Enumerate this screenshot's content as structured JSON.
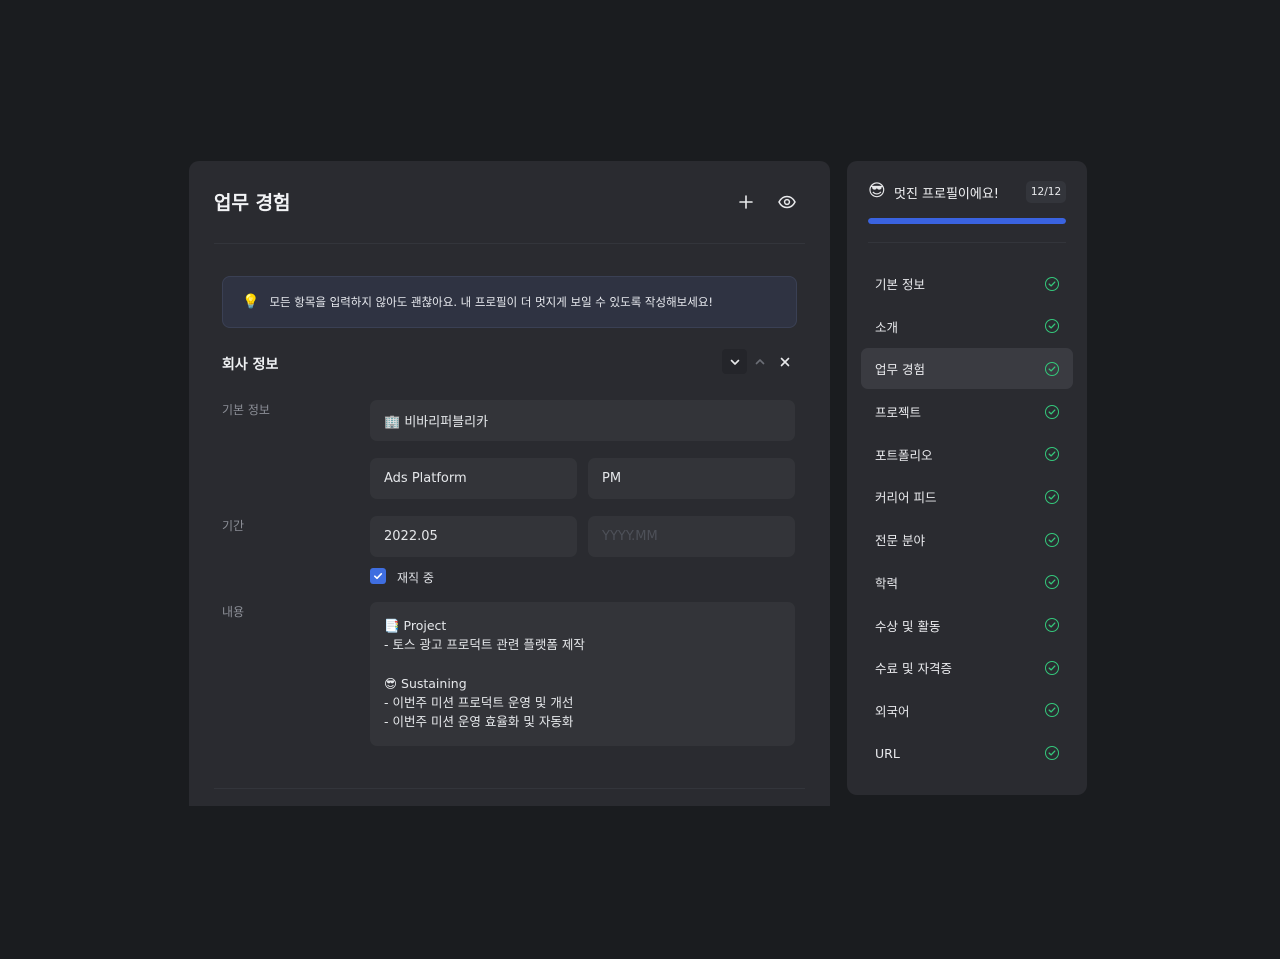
{
  "editor": {
    "title": "업무 경험",
    "tip": "모든 항목을 입력하지 않아도 괜찮아요. 내 프로필이 더 멋지게 보일 수 있도록 작성해보세요!",
    "section_title": "회사 정보",
    "labels": {
      "basic": "기본 정보",
      "period": "기간",
      "content": "내용"
    },
    "company": "🏢 비바리퍼블리카",
    "team": "Ads Platform",
    "role": "PM",
    "start": "2022.05",
    "end_placeholder": "YYYY.MM",
    "currently_employed": "재직 중",
    "content_text": "📑 Project\n- 토스 광고 프로덕트 관련 플랫폼 제작\n\n😎 Sustaining\n- 이번주 미션 프로덕트 운영 및 개선\n- 이번주 미션 운영 효율화 및 자동화"
  },
  "sidebar": {
    "emoji": "😎",
    "title": "멋진 프로필이에요!",
    "count": "12/12",
    "progress": 1.0,
    "items": [
      {
        "label": "기본 정보"
      },
      {
        "label": "소개"
      },
      {
        "label": "업무 경험"
      },
      {
        "label": "프로젝트"
      },
      {
        "label": "포트폴리오"
      },
      {
        "label": "커리어 피드"
      },
      {
        "label": "전문 분야"
      },
      {
        "label": "학력"
      },
      {
        "label": "수상 및 활동"
      },
      {
        "label": "수료 및 자격증"
      },
      {
        "label": "외국어"
      },
      {
        "label": "URL"
      }
    ],
    "active_item": "업무 경험"
  },
  "colors": {
    "accent": "#3a63e0",
    "check": "#34c77b"
  }
}
